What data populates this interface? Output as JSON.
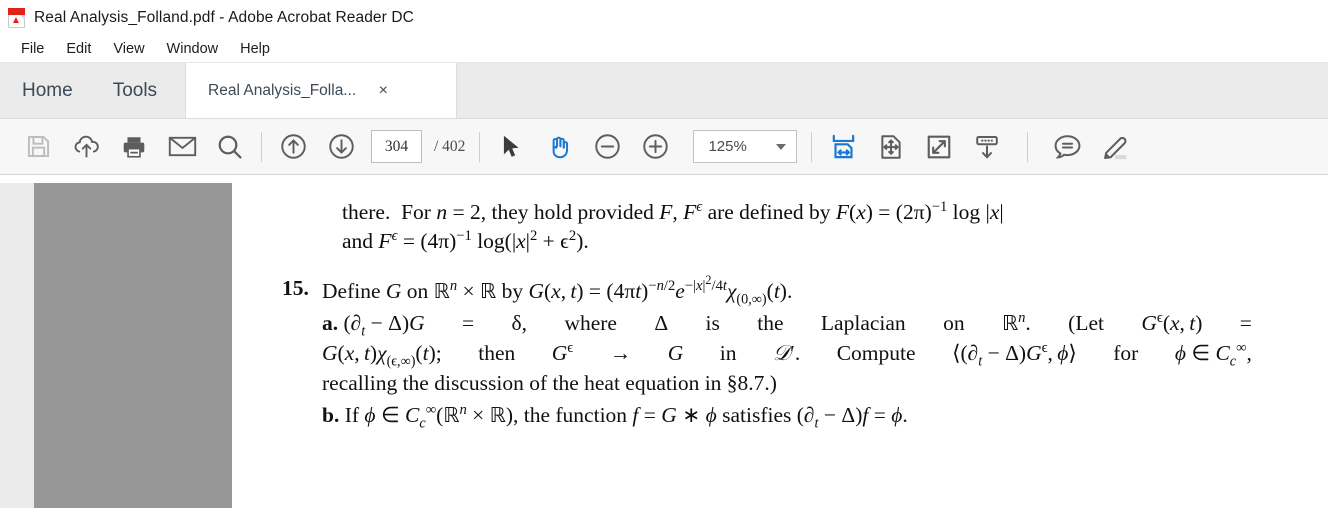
{
  "window": {
    "title": "Real Analysis_Folland.pdf - Adobe Acrobat Reader DC",
    "app_icon": "pdf-file-icon"
  },
  "menubar": {
    "items": [
      {
        "label": "File"
      },
      {
        "label": "Edit"
      },
      {
        "label": "View"
      },
      {
        "label": "Window"
      },
      {
        "label": "Help"
      }
    ]
  },
  "tabs": {
    "home_label": "Home",
    "tools_label": "Tools",
    "document_tab_label": "Real Analysis_Folla...",
    "close_glyph": "×"
  },
  "toolbar": {
    "save_icon": "save-floppy-icon",
    "upload_icon": "cloud-upload-icon",
    "print_icon": "print-icon",
    "email_icon": "email-envelope-icon",
    "search_icon": "search-magnifier-icon",
    "prev_page_icon": "arrow-up-circle-icon",
    "next_page_icon": "arrow-down-circle-icon",
    "current_page": "304",
    "page_separator": "/",
    "total_pages": "402",
    "page_count_text": "/  402",
    "select_tool_icon": "cursor-arrow-icon",
    "hand_tool_icon": "hand-pan-icon",
    "zoom_out_icon": "zoom-out-circle-icon",
    "zoom_in_icon": "zoom-in-circle-icon",
    "zoom_level": "125%",
    "zoom_dropdown_icon": "chevron-down-icon",
    "fit_width_icon": "fit-page-width-icon",
    "pan_page_icon": "page-move-icon",
    "fullscreen_icon": "expand-fullscreen-icon",
    "scroll_mode_icon": "scroll-down-icon",
    "comment_icon": "comment-bubble-icon",
    "highlight_icon": "highlighter-pen-icon",
    "accent_color": "#1a77d2",
    "icon_color": "#5a5a5a",
    "disabled_icon_color": "#b8b8b8"
  },
  "document": {
    "paragraph_1": {
      "line_1_a": "there.  For ",
      "line_1_n": "n",
      "line_1_eq": " = 2, they hold provided ",
      "line_1_F": "F",
      "line_1_comma": ", ",
      "line_1_Feps": "Fϵ",
      "line_1_b": " are defined by ",
      "line_1_Fx": "F(x) = (2π)−1 log |x|",
      "line_2": "and Fϵ = (4π)−1 log(|x|2 + ϵ2)."
    },
    "exercise": {
      "number": "15.",
      "intro": "Define G on ℝn × ℝ by G(x, t) = (4πt)−n/2 e−|x|2/4t χ(0,∞)(t).",
      "part_a_label": "a.",
      "part_a_line1": "(∂t − Δ)G = δ, where Δ is the Laplacian on ℝn.  (Let Gϵ(x, t) =",
      "part_a_line2": "G(x, t)χ(ϵ,∞)(t); then Gϵ → G in 𝒟′. Compute 〈(∂t − Δ)Gϵ, φ〉 for φ ∈ Cc∞,",
      "part_a_line3": "recalling the discussion of the heat equation in §8.7.)",
      "part_b_label": "b.",
      "part_b_line1": "If φ ∈ Cc∞(ℝn × ℝ), the function f = G ∗ φ satisfies (∂t − Δ)f = φ."
    }
  }
}
